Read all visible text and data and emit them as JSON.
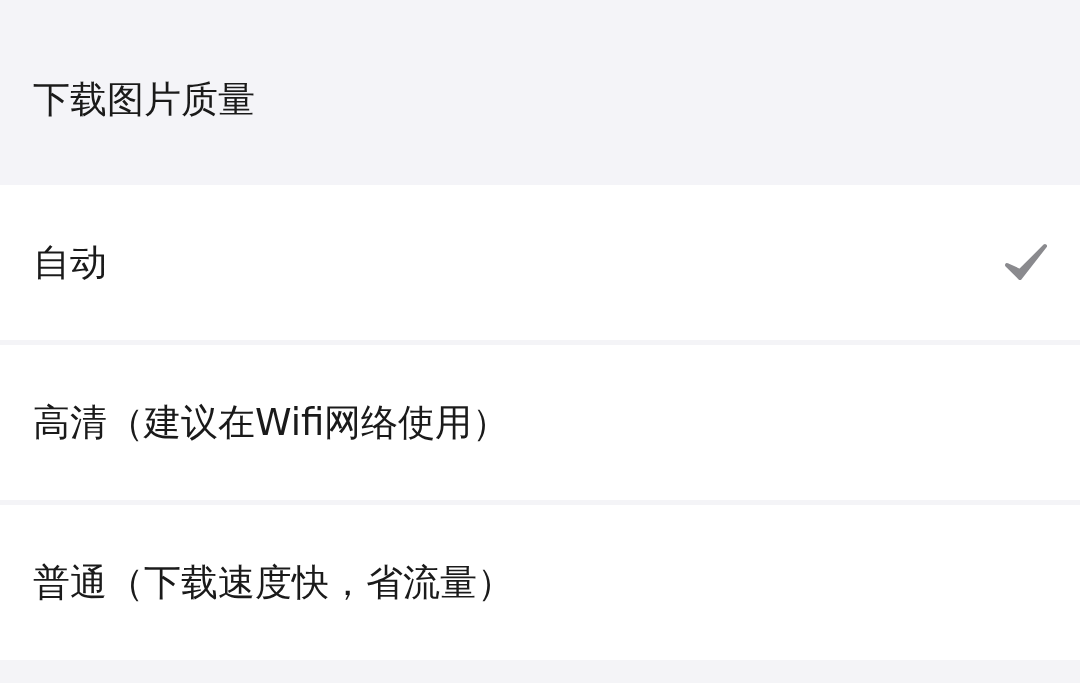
{
  "header": {
    "title": "下载图片质量"
  },
  "options": [
    {
      "label": "自动",
      "selected": true
    },
    {
      "label": "高清（建议在Wifi网络使用）",
      "selected": false
    },
    {
      "label": "普通（下载速度快，省流量）",
      "selected": false
    }
  ]
}
